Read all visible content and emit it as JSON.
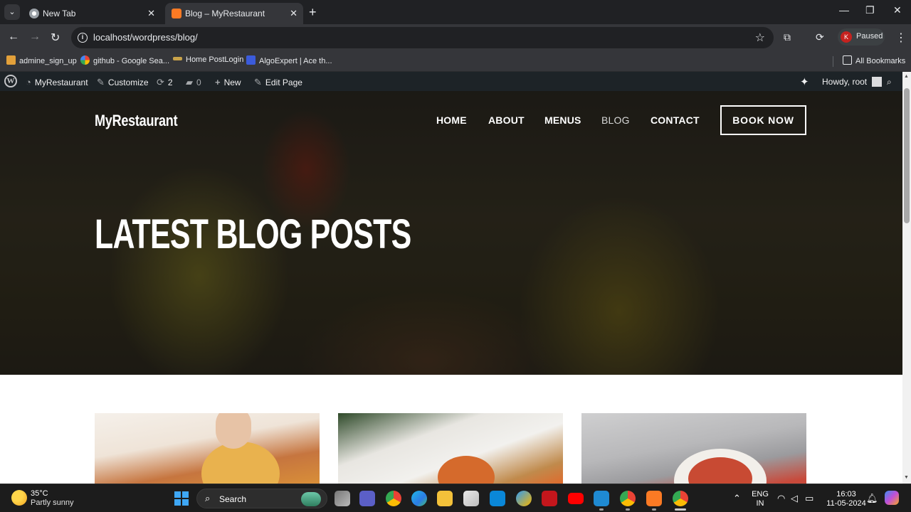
{
  "browser": {
    "tabs": [
      {
        "title": "New Tab",
        "active": false
      },
      {
        "title": "Blog – MyRestaurant",
        "active": true
      }
    ],
    "url": "localhost/wordpress/blog/",
    "profile_initial": "K",
    "profile_status": "Paused",
    "bookmarks": [
      {
        "label": "admine_sign_up"
      },
      {
        "label": "github - Google Sea..."
      },
      {
        "label": "Home PostLogin"
      },
      {
        "label": "AlgoExpert | Ace th..."
      }
    ],
    "all_bookmarks": "All Bookmarks"
  },
  "wp_admin_bar": {
    "site_name": "MyRestaurant",
    "customize": "Customize",
    "updates_count": "2",
    "comments_count": "0",
    "new_label": "New",
    "edit_page": "Edit Page",
    "howdy": "Howdy, root"
  },
  "site": {
    "logo": "MyRestaurant",
    "nav": [
      {
        "label": "HOME"
      },
      {
        "label": "ABOUT"
      },
      {
        "label": "MENUS"
      },
      {
        "label": "BLOG",
        "current": true
      },
      {
        "label": "CONTACT"
      }
    ],
    "cta": "BOOK NOW",
    "hero_title": "LATEST BLOG POSTS"
  },
  "taskbar": {
    "weather_temp": "35°C",
    "weather_desc": "Partly sunny",
    "search_label": "Search",
    "lang_top": "ENG",
    "lang_bottom": "IN",
    "time": "16:03",
    "date": "11-05-2024"
  },
  "colors": {
    "wp_admin_bar": "#1d2327",
    "chrome_dark": "#202124",
    "chrome_toolbar": "#35363a",
    "taskbar": "#1c1c1c"
  }
}
